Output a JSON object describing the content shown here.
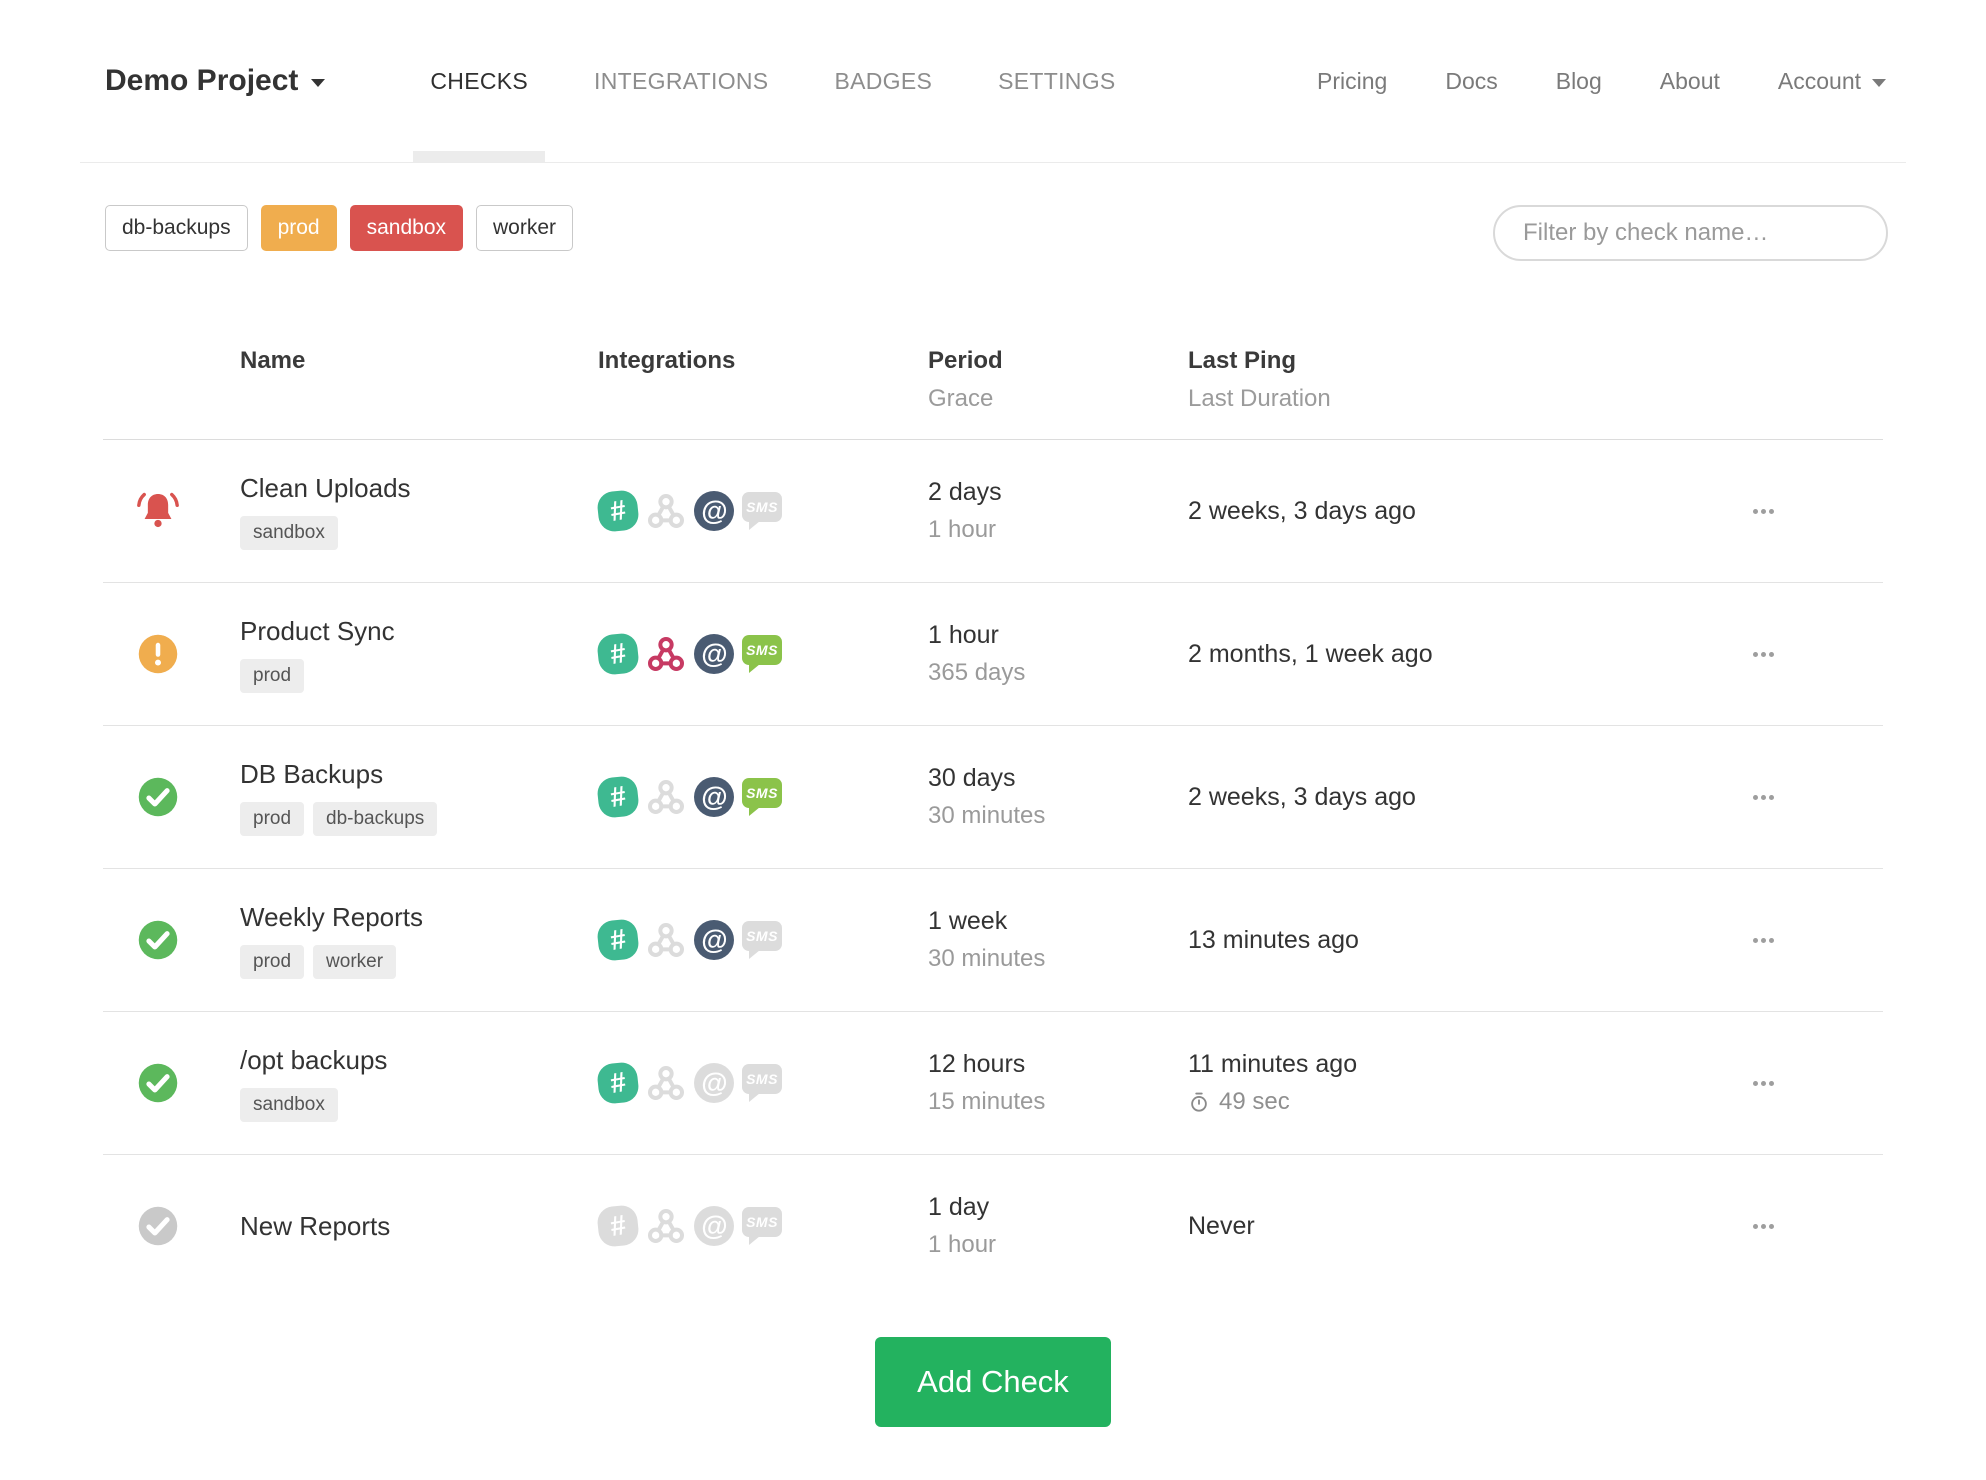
{
  "nav": {
    "project": "Demo Project",
    "tabs": [
      {
        "label": "CHECKS",
        "active": true
      },
      {
        "label": "INTEGRATIONS",
        "active": false
      },
      {
        "label": "BADGES",
        "active": false
      },
      {
        "label": "SETTINGS",
        "active": false
      }
    ],
    "links": [
      "Pricing",
      "Docs",
      "Blog",
      "About"
    ],
    "account_label": "Account"
  },
  "filters": {
    "tags": [
      {
        "label": "db-backups",
        "style": "outline"
      },
      {
        "label": "prod",
        "style": "orange"
      },
      {
        "label": "sandbox",
        "style": "red"
      },
      {
        "label": "worker",
        "style": "outline"
      }
    ],
    "search_placeholder": "Filter by check name…"
  },
  "table": {
    "headers": {
      "name": "Name",
      "integrations": "Integrations",
      "period": "Period",
      "grace": "Grace",
      "last_ping": "Last Ping",
      "last_duration": "Last Duration"
    },
    "integration_types": [
      "slack",
      "webhook",
      "email",
      "sms"
    ],
    "rows": [
      {
        "status": "alert",
        "name": "Clean Uploads",
        "tags": [
          "sandbox"
        ],
        "integrations": [
          true,
          false,
          true,
          false
        ],
        "period": "2 days",
        "grace": "1 hour",
        "last_ping": "2 weeks, 3 days ago",
        "last_duration": ""
      },
      {
        "status": "warn",
        "name": "Product Sync",
        "tags": [
          "prod"
        ],
        "integrations": [
          true,
          true,
          true,
          true
        ],
        "period": "1 hour",
        "grace": "365 days",
        "last_ping": "2 months, 1 week ago",
        "last_duration": ""
      },
      {
        "status": "ok",
        "name": "DB Backups",
        "tags": [
          "prod",
          "db-backups"
        ],
        "integrations": [
          true,
          false,
          true,
          true
        ],
        "period": "30 days",
        "grace": "30 minutes",
        "last_ping": "2 weeks, 3 days ago",
        "last_duration": ""
      },
      {
        "status": "ok",
        "name": "Weekly Reports",
        "tags": [
          "prod",
          "worker"
        ],
        "integrations": [
          true,
          false,
          true,
          false
        ],
        "period": "1 week",
        "grace": "30 minutes",
        "last_ping": "13 minutes ago",
        "last_duration": ""
      },
      {
        "status": "ok",
        "name": "/opt backups",
        "tags": [
          "sandbox"
        ],
        "integrations": [
          true,
          false,
          false,
          false
        ],
        "period": "12 hours",
        "grace": "15 minutes",
        "last_ping": "11 minutes ago",
        "last_duration": "49 sec"
      },
      {
        "status": "new",
        "name": "New Reports",
        "tags": [],
        "integrations": [
          false,
          false,
          false,
          false
        ],
        "period": "1 day",
        "grace": "1 hour",
        "last_ping": "Never",
        "last_duration": ""
      }
    ]
  },
  "footer": {
    "add_check_label": "Add Check"
  },
  "colors": {
    "slack": "#3eb991",
    "webhook": "#c73a63",
    "email": "#4a5b72",
    "sms": "#8bc34a",
    "ok": "#5cb85c",
    "warn": "#f0ad4e",
    "alert": "#d9534f",
    "new": "#c9c9c9",
    "off": "#dcdcdc",
    "tag_orange": "#f0ad4e",
    "tag_red": "#d9534f",
    "button_green": "#23b25f"
  }
}
